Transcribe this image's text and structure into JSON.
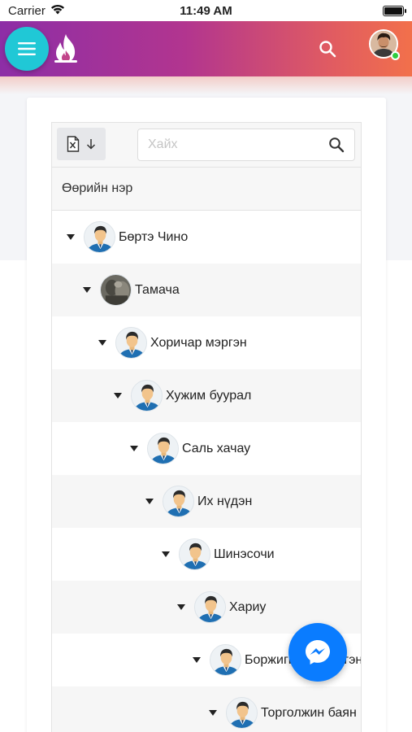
{
  "status_bar": {
    "carrier": "Carrier",
    "time": "11:49 AM"
  },
  "header": {
    "menu_icon": "hamburger-icon",
    "logo_icon": "flame-logo",
    "search_icon": "search-icon"
  },
  "toolbar": {
    "export_icon": "excel-export-icon",
    "search_placeholder": "Хайх"
  },
  "table": {
    "column_header": "Өөрийн нэр",
    "rows": [
      {
        "name": "Бөртэ Чино"
      },
      {
        "name": "Тамача"
      },
      {
        "name": "Хоричар мэргэн"
      },
      {
        "name": "Хужим буурал"
      },
      {
        "name": "Саль хачау"
      },
      {
        "name": "Их нүдэн"
      },
      {
        "name": "Шинэсочи"
      },
      {
        "name": "Хариу"
      },
      {
        "name": "Боржигидай мэргэн"
      },
      {
        "name": "Торголжин баян"
      }
    ]
  },
  "colors": {
    "header_start": "#8d2ea6",
    "header_end": "#f2704b",
    "menu_button": "#20c8d6",
    "messenger": "#0a7cff"
  }
}
